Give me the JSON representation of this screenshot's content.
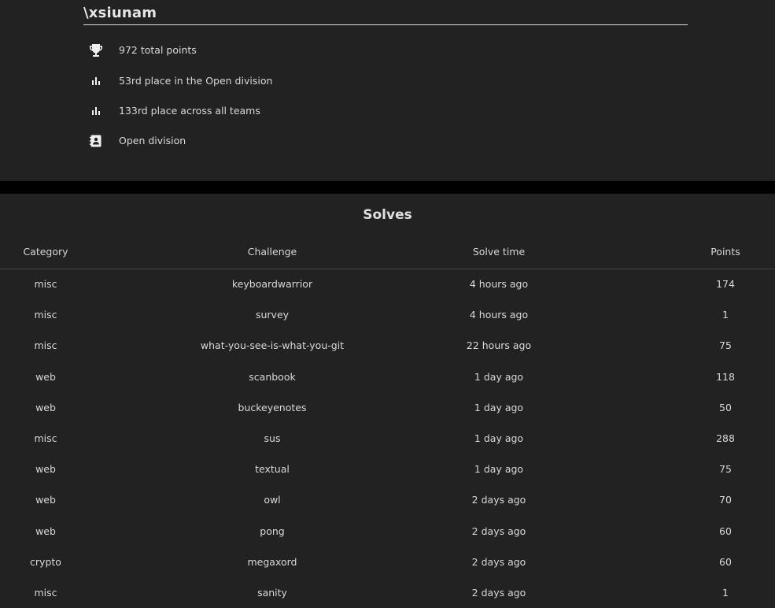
{
  "team": {
    "name": "\\xsiunam",
    "stats": [
      {
        "icon": "trophy-icon",
        "text": "972 total points"
      },
      {
        "icon": "bar-chart-icon",
        "text": "53rd place in the Open division"
      },
      {
        "icon": "bar-chart-icon",
        "text": "133rd place across all teams"
      },
      {
        "icon": "contact-card-icon",
        "text": "Open division"
      }
    ]
  },
  "solves": {
    "title": "Solves",
    "columns": {
      "category": "Category",
      "challenge": "Challenge",
      "solve_time": "Solve time",
      "points": "Points"
    },
    "rows": [
      {
        "category": "misc",
        "challenge": "keyboardwarrior",
        "solve_time": "4 hours ago",
        "points": "174"
      },
      {
        "category": "misc",
        "challenge": "survey",
        "solve_time": "4 hours ago",
        "points": "1"
      },
      {
        "category": "misc",
        "challenge": "what-you-see-is-what-you-git",
        "solve_time": "22 hours ago",
        "points": "75"
      },
      {
        "category": "web",
        "challenge": "scanbook",
        "solve_time": "1 day ago",
        "points": "118"
      },
      {
        "category": "web",
        "challenge": "buckeyenotes",
        "solve_time": "1 day ago",
        "points": "50"
      },
      {
        "category": "misc",
        "challenge": "sus",
        "solve_time": "1 day ago",
        "points": "288"
      },
      {
        "category": "web",
        "challenge": "textual",
        "solve_time": "1 day ago",
        "points": "75"
      },
      {
        "category": "web",
        "challenge": "owl",
        "solve_time": "2 days ago",
        "points": "70"
      },
      {
        "category": "web",
        "challenge": "pong",
        "solve_time": "2 days ago",
        "points": "60"
      },
      {
        "category": "crypto",
        "challenge": "megaxord",
        "solve_time": "2 days ago",
        "points": "60"
      },
      {
        "category": "misc",
        "challenge": "sanity",
        "solve_time": "2 days ago",
        "points": "1"
      }
    ]
  }
}
